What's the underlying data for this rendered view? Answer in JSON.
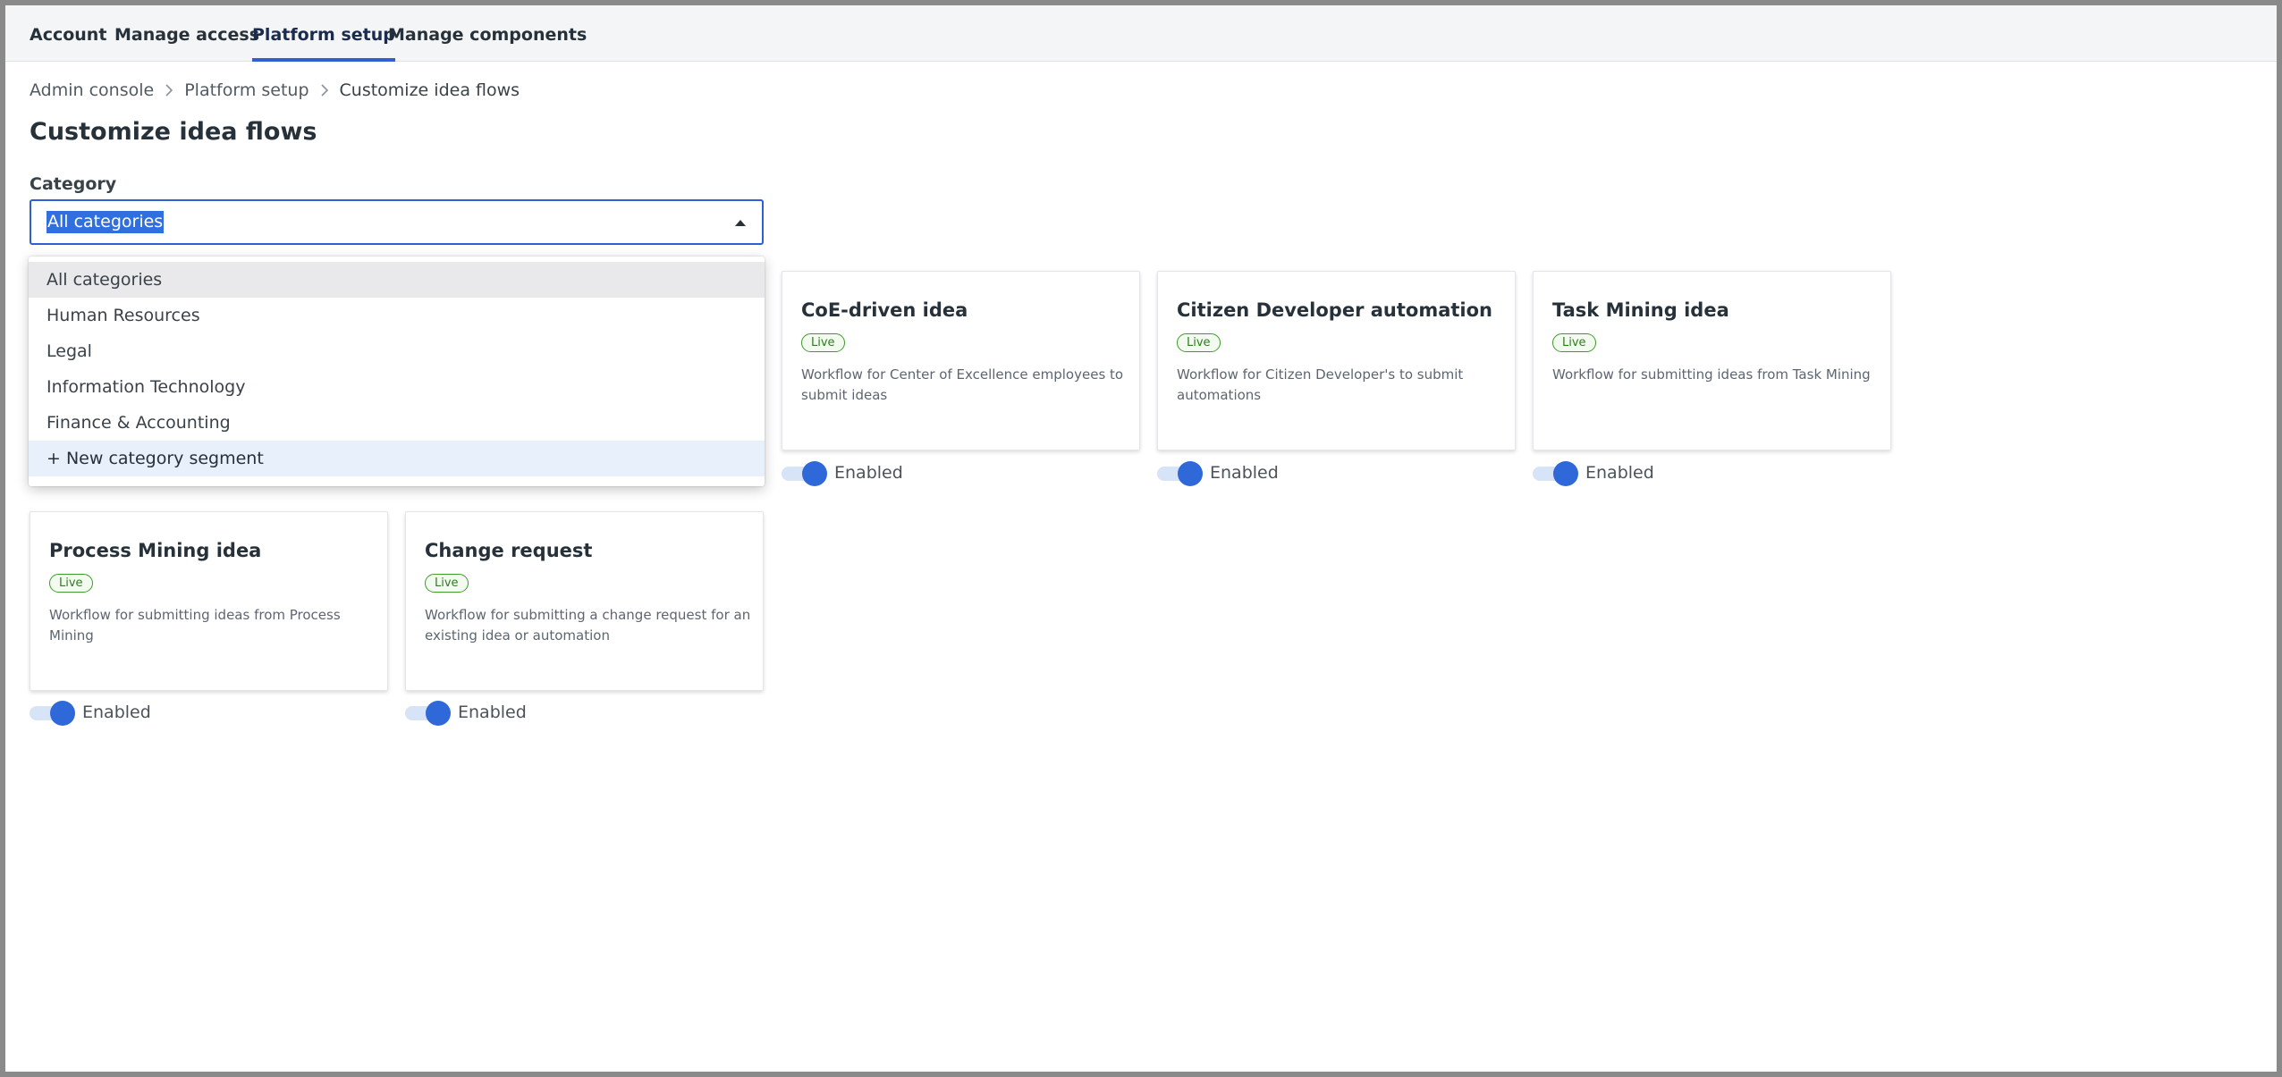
{
  "nav": {
    "tabs": [
      {
        "label": "Account"
      },
      {
        "label": "Manage access"
      },
      {
        "label": "Platform setup"
      },
      {
        "label": "Manage components"
      }
    ],
    "active_tab": "Platform setup"
  },
  "breadcrumb": {
    "items": [
      "Admin console",
      "Platform setup",
      "Customize idea flows"
    ]
  },
  "page": {
    "title": "Customize idea flows"
  },
  "category_filter": {
    "label": "Category",
    "selected": "All categories",
    "options": [
      "All categories",
      "Human Resources",
      "Legal",
      "Information Technology",
      "Finance & Accounting",
      "+ New category segment"
    ]
  },
  "cards": [
    {
      "title": "CoE-driven idea",
      "status": "Live",
      "description": "Workflow for Center of Excellence employees to submit ideas",
      "toggle_label": "Enabled",
      "enabled": true
    },
    {
      "title": "Citizen Developer automation",
      "status": "Live",
      "description": "Workflow for Citizen Developer's to submit automations",
      "toggle_label": "Enabled",
      "enabled": true
    },
    {
      "title": "Task Mining idea",
      "status": "Live",
      "description": "Workflow for submitting ideas from Task Mining",
      "toggle_label": "Enabled",
      "enabled": true
    },
    {
      "title": "Process Mining idea",
      "status": "Live",
      "description": "Workflow for submitting ideas from Process Mining",
      "toggle_label": "Enabled",
      "enabled": true
    },
    {
      "title": "Change request",
      "status": "Live",
      "description": "Workflow for submitting a change request for an existing idea or automation",
      "toggle_label": "Enabled",
      "enabled": true
    }
  ],
  "colors": {
    "accent": "#2f5fd0",
    "badge_green": "#3f9b2a",
    "toggle_on": "#2f68d8"
  }
}
